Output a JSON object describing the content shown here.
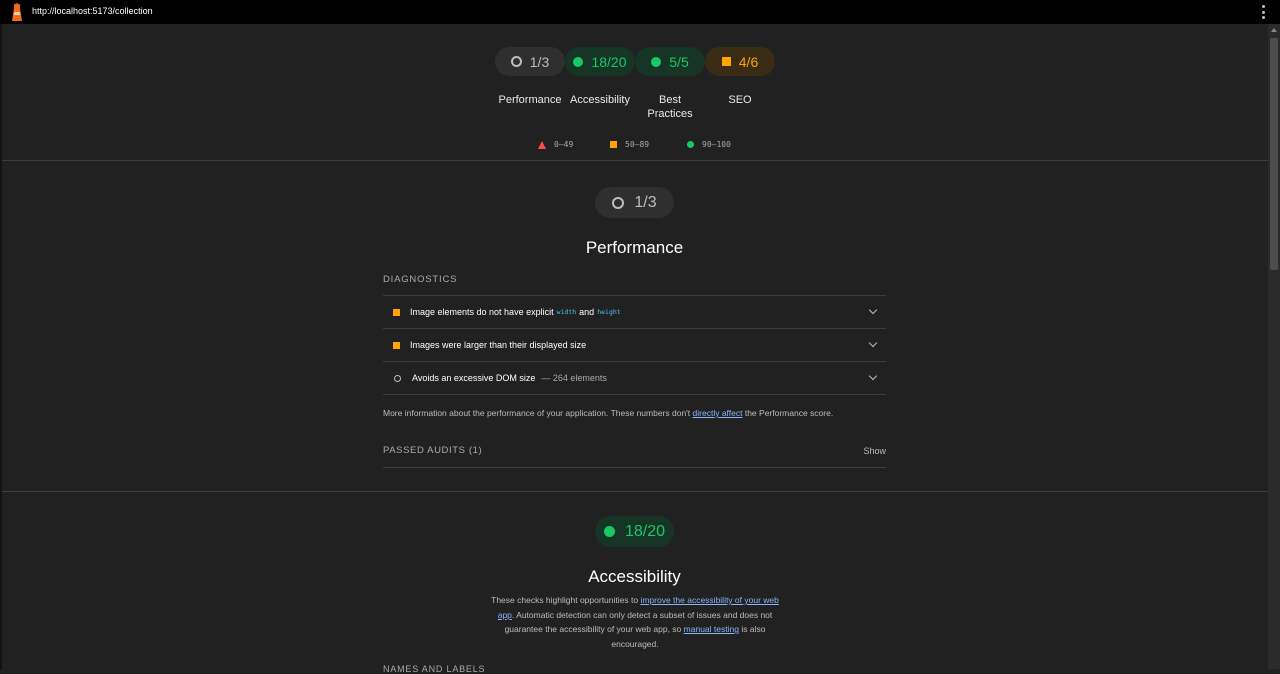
{
  "browser": {
    "url": "http://localhost:5173/collection"
  },
  "summary": {
    "gauges": [
      {
        "score": "1/3",
        "label": "Performance",
        "status": "neutral"
      },
      {
        "score": "18/20",
        "label": "Accessibility",
        "status": "pass"
      },
      {
        "score": "5/5",
        "label": "Best Practices",
        "status": "pass"
      },
      {
        "score": "4/6",
        "label": "SEO",
        "status": "average"
      }
    ],
    "legend": [
      "0–49",
      "50–89",
      "90–100"
    ]
  },
  "performance": {
    "score": "1/3",
    "title": "Performance",
    "group_label": "DIAGNOSTICS",
    "audits": [
      {
        "text_before": "Image elements do not have explicit",
        "code1": "width",
        "and": "and",
        "code2": "height",
        "status": "average"
      },
      {
        "text": "Images were larger than their displayed size",
        "status": "average"
      },
      {
        "text": "Avoids an excessive DOM size",
        "detail": "— 264 elements",
        "status": "neutral"
      }
    ],
    "info_before": "More information about the performance of your application. These numbers don't",
    "info_link": "directly affect",
    "info_after": "the Performance score.",
    "passed_label": "PASSED AUDITS (1)",
    "show_label": "Show"
  },
  "accessibility": {
    "score": "18/20",
    "title": "Accessibility",
    "desc_1": "These checks highlight opportunities to",
    "desc_link1": "improve the accessibility of your web app",
    "desc_2": ". Automatic detection can only detect a subset of issues and does not guarantee the accessibility of your web app, so",
    "desc_link2": "manual testing",
    "desc_3": "is also encouraged.",
    "next_group": "NAMES AND LABELS"
  },
  "colors": {
    "pass": "#18c964",
    "average": "#ffa400",
    "fail": "#ff4e42",
    "neutral": "#bdbdbd",
    "link": "#8ab4f8"
  }
}
